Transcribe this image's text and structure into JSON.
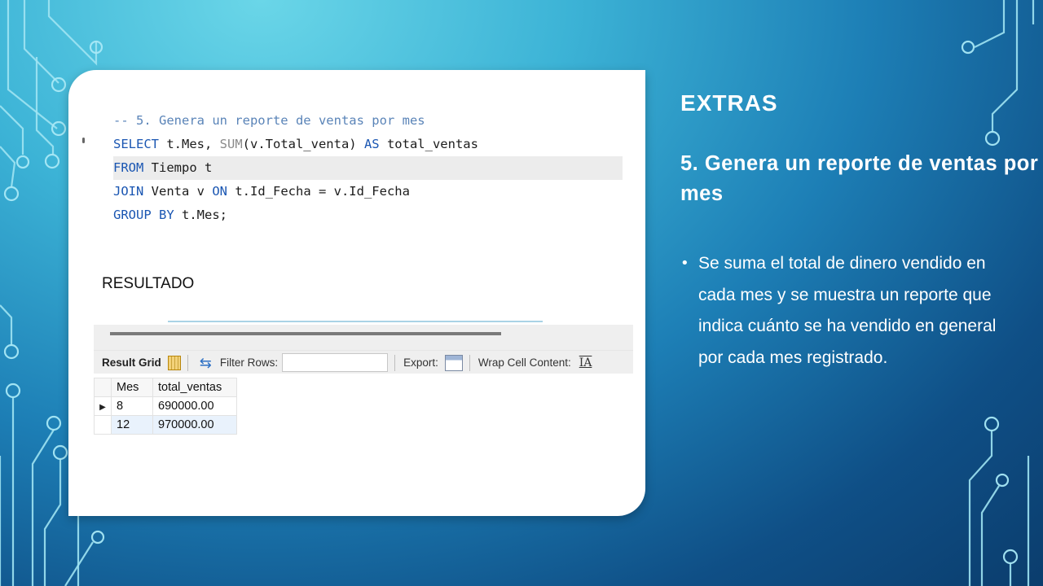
{
  "slide": {
    "title": "EXTRAS",
    "subtitle": "5. Genera un reporte de ventas por mes",
    "bullet": "Se suma el total de dinero vendido en cada mes y se muestra un reporte que indica cuánto se ha vendido en general por cada mes registrado."
  },
  "code": {
    "comment": "-- 5. Genera un reporte de ventas por mes",
    "line2": {
      "kw1": "SELECT",
      "t1": " t.Mes, ",
      "fn": "SUM",
      "t2": "(v.Total_venta) ",
      "kw2": "AS",
      "t3": " total_ventas"
    },
    "line3": {
      "kw1": "FROM",
      "t1": " Tiempo t"
    },
    "line4": {
      "kw1": "JOIN",
      "t1": " Venta v ",
      "kw2": "ON",
      "t2": " t.Id_Fecha = v.Id_Fecha"
    },
    "line5": {
      "kw1": "GROUP BY",
      "t1": " t.Mes;"
    }
  },
  "result_label": "RESULTADO",
  "toolbar": {
    "result_grid": "Result Grid",
    "filter_rows": "Filter Rows:",
    "filter_value": "",
    "export": "Export:",
    "wrap_cell": "Wrap Cell Content:",
    "wrap_icon": "IA"
  },
  "table": {
    "headers": [
      "Mes",
      "total_ventas"
    ],
    "rows": [
      [
        "8",
        "690000.00"
      ],
      [
        "12",
        "970000.00"
      ]
    ]
  },
  "icons": {
    "grid": "result-grid-icon",
    "refresh": "refresh-icon",
    "export": "export-icon",
    "wrap": "wrap-cell-icon",
    "row_pointer": "row-pointer-icon"
  },
  "colors": {
    "comment": "#5a84b8",
    "keyword": "#1a56b2",
    "function": "#8a8a8a",
    "selected_row": "#e9f2fc"
  }
}
